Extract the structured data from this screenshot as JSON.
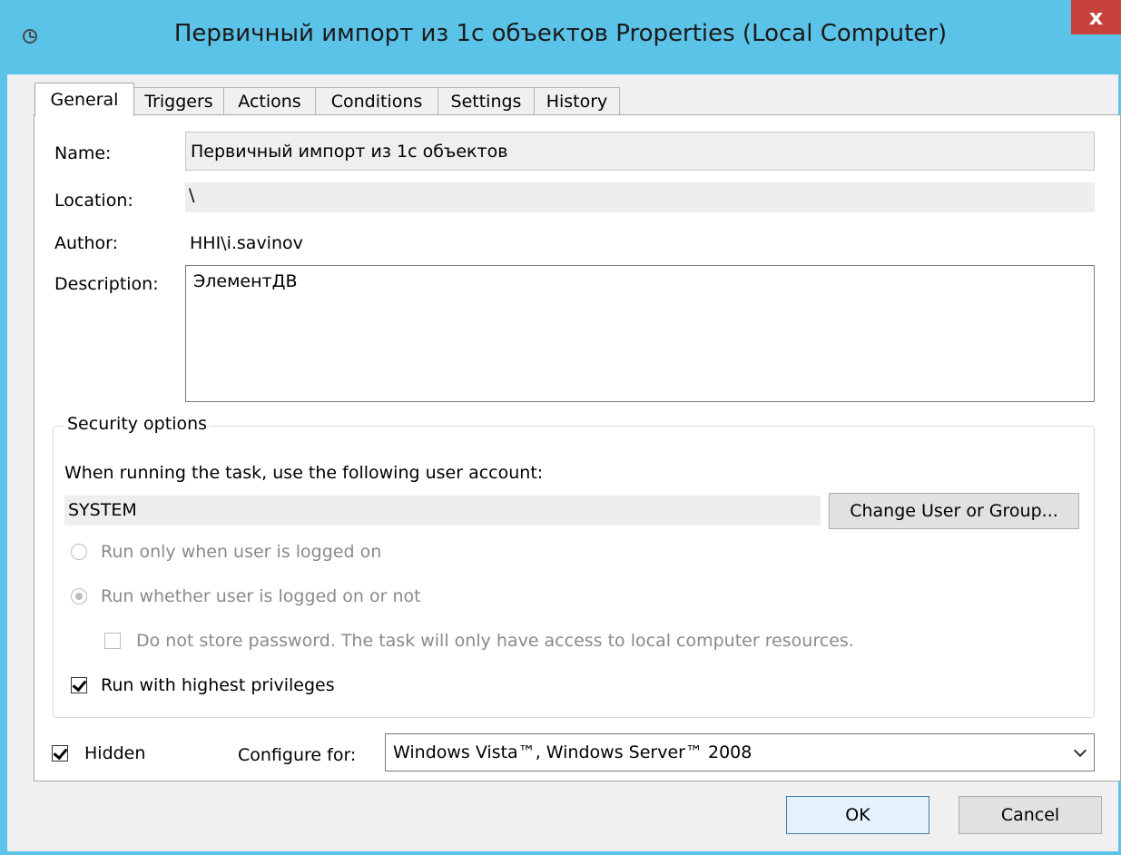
{
  "window": {
    "title": "Первичный импорт из 1с объектов Properties (Local Computer)",
    "close_label": "x"
  },
  "tabs": [
    {
      "label": "General"
    },
    {
      "label": "Triggers"
    },
    {
      "label": "Actions"
    },
    {
      "label": "Conditions"
    },
    {
      "label": "Settings"
    },
    {
      "label": "History"
    }
  ],
  "general": {
    "name_label": "Name:",
    "name_value": "Первичный импорт из 1с объектов",
    "location_label": "Location:",
    "location_value": "\\",
    "author_label": "Author:",
    "author_value": "HHI\\i.savinov",
    "description_label": "Description:",
    "description_value": "ЭлементДВ"
  },
  "security": {
    "group_title": "Security options",
    "account_prompt": "When running the task, use the following user account:",
    "account_value": "SYSTEM",
    "change_button": "Change User or Group...",
    "radio_logged_on": "Run only when user is logged on",
    "radio_whether": "Run whether user is logged on or not",
    "no_store_password": "Do not store password.  The task will only have access to local computer resources.",
    "highest_privileges": "Run with highest privileges"
  },
  "bottom": {
    "hidden_label": "Hidden",
    "configure_label": "Configure for:",
    "configure_value": "Windows Vista™, Windows Server™ 2008"
  },
  "buttons": {
    "ok": "OK",
    "cancel": "Cancel"
  }
}
